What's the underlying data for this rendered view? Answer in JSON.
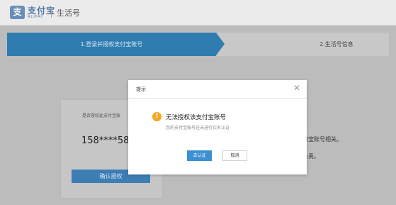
{
  "header": {
    "logo_mark": "支",
    "logo_cn": "支付宝",
    "logo_en": "ALIPAY",
    "section": "生活号"
  },
  "steps": [
    {
      "label": "1.登录并授权支付宝账号",
      "active": true
    },
    {
      "label": "2.生活号信息",
      "active": false
    }
  ],
  "card": {
    "title": "是否授权此支付宝账",
    "phone": "158****58",
    "confirm_label": "确认授权"
  },
  "side_text": {
    "line1": "定的支付宝账号相关。",
    "line2": "有操作负责。"
  },
  "modal": {
    "title": "提示",
    "close_glyph": "✕",
    "icon_glyph": "!",
    "message": "无法授权该支付宝账号",
    "sub_message": "您的支付宝账号还未进行实名认证",
    "primary_label": "去认证",
    "cancel_label": "取消"
  },
  "colors": {
    "accent": "#2f7db0",
    "warning": "#f5a623",
    "primary_button": "#3c8fd1"
  }
}
